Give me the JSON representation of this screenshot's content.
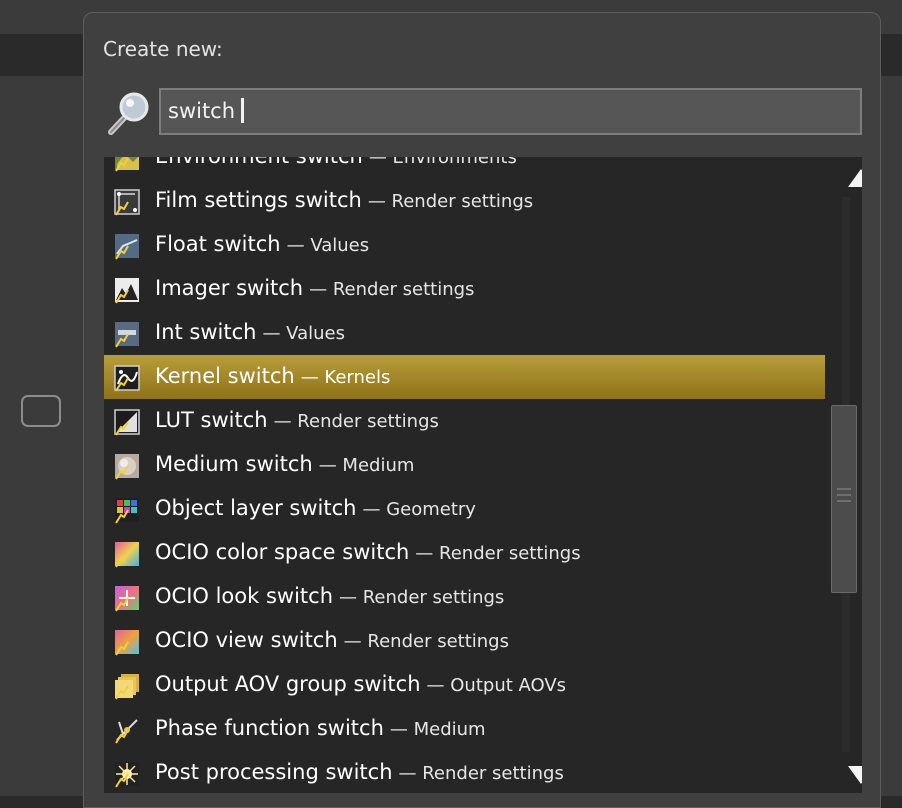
{
  "popup": {
    "title": "Create new:",
    "search": {
      "value": "switch",
      "icon": "magnifier-icon"
    }
  },
  "list": {
    "items": [
      {
        "name": "Environment switch",
        "category": "— Environments",
        "icon": "environment-icon"
      },
      {
        "name": "Film settings switch",
        "category": "— Render settings",
        "icon": "film-settings-icon"
      },
      {
        "name": "Float switch",
        "category": "— Values",
        "icon": "float-icon"
      },
      {
        "name": "Imager switch",
        "category": "— Render settings",
        "icon": "imager-icon"
      },
      {
        "name": "Int switch",
        "category": "— Values",
        "icon": "int-icon"
      },
      {
        "name": "Kernel switch",
        "category": "— Kernels",
        "icon": "kernel-icon",
        "selected": true
      },
      {
        "name": "LUT switch",
        "category": "— Render settings",
        "icon": "lut-icon"
      },
      {
        "name": "Medium switch",
        "category": "— Medium",
        "icon": "medium-icon"
      },
      {
        "name": "Object layer switch",
        "category": "— Geometry",
        "icon": "object-layer-icon"
      },
      {
        "name": "OCIO color space switch",
        "category": "— Render settings",
        "icon": "ocio-color-space-icon"
      },
      {
        "name": "OCIO look switch",
        "category": "— Render settings",
        "icon": "ocio-look-icon"
      },
      {
        "name": "OCIO view switch",
        "category": "— Render settings",
        "icon": "ocio-view-icon"
      },
      {
        "name": "Output AOV group switch",
        "category": "— Output AOVs",
        "icon": "output-aov-group-icon"
      },
      {
        "name": "Phase function switch",
        "category": "— Medium",
        "icon": "phase-function-icon"
      },
      {
        "name": "Post processing switch",
        "category": "— Render settings",
        "icon": "post-processing-icon"
      }
    ]
  },
  "colors": {
    "selection_top": "#b79e3b",
    "selection_bottom": "#8f7218",
    "list_background": "#262626",
    "popup_background": "#404040"
  }
}
